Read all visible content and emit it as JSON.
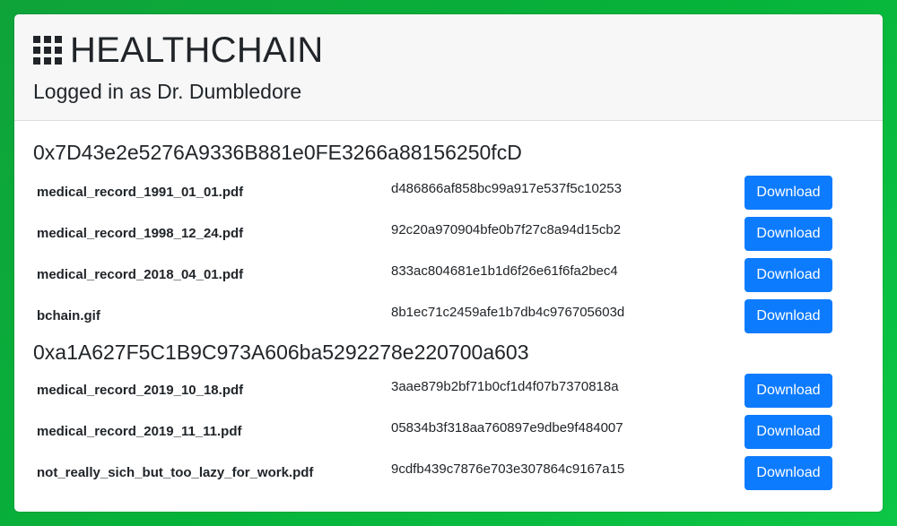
{
  "header": {
    "title": "HEALTHCHAIN",
    "logged_in": "Logged in as Dr. Dumbledore"
  },
  "accounts": [
    {
      "address": "0x7D43e2e5276A9336B881e0FE3266a88156250fcD",
      "files": [
        {
          "name": "medical_record_1991_01_01.pdf",
          "hash": "d486866af858bc99a917e537f5c10253",
          "button": "Download"
        },
        {
          "name": "medical_record_1998_12_24.pdf",
          "hash": "92c20a970904bfe0b7f27c8a94d15cb2",
          "button": "Download"
        },
        {
          "name": "medical_record_2018_04_01.pdf",
          "hash": "833ac804681e1b1d6f26e61f6fa2bec4",
          "button": "Download"
        },
        {
          "name": "bchain.gif",
          "hash": "8b1ec71c2459afe1b7db4c976705603d",
          "button": "Download"
        }
      ]
    },
    {
      "address": "0xa1A627F5C1B9C973A606ba5292278e220700a603",
      "files": [
        {
          "name": "medical_record_2019_10_18.pdf",
          "hash": "3aae879b2bf71b0cf1d4f07b7370818a",
          "button": "Download"
        },
        {
          "name": "medical_record_2019_11_11.pdf",
          "hash": "05834b3f318aa760897e9dbe9f484007",
          "button": "Download"
        },
        {
          "name": "not_really_sich_but_too_lazy_for_work.pdf",
          "hash": "9cdfb439c7876e703e307864c9167a15",
          "button": "Download"
        }
      ]
    }
  ]
}
